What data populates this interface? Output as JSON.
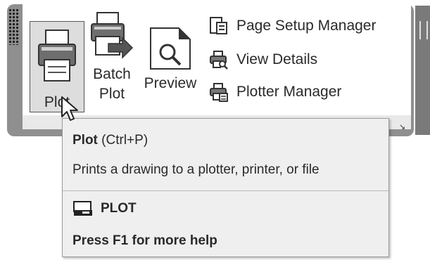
{
  "ribbon": {
    "buttons": {
      "plot": {
        "label": "Plot",
        "icon": "printer-icon"
      },
      "batch_plot": {
        "label_line1": "Batch",
        "label_line2": "Plot",
        "icon": "batch-plot-icon"
      },
      "preview": {
        "label": "Preview",
        "icon": "preview-icon"
      }
    },
    "small_buttons": {
      "page_setup_manager": {
        "label": "Page Setup Manager",
        "icon": "page-setup-icon"
      },
      "view_details": {
        "label": "View Details",
        "icon": "view-details-icon"
      },
      "plotter_manager": {
        "label": "Plotter Manager",
        "icon": "plotter-manager-icon"
      }
    },
    "launcher_glyph": "↘"
  },
  "tooltip": {
    "title": "Plot",
    "shortcut": "(Ctrl+P)",
    "description": "Prints a drawing to a plotter, printer, or file",
    "command": "PLOT",
    "command_icon": "plot-command-icon",
    "help": "Press F1 for more help"
  },
  "colors": {
    "ribbon_border": "#8f8f8f",
    "ribbon_bg": "#ffffff",
    "tooltip_bg": "#efefef",
    "text": "#2a2a2a"
  }
}
